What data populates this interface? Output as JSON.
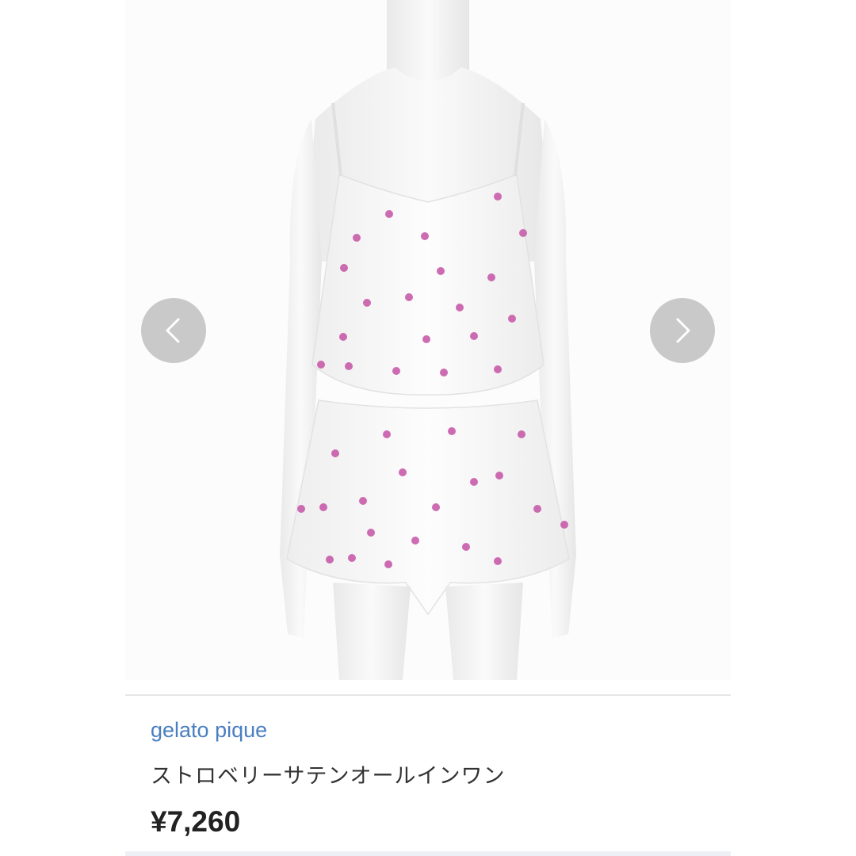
{
  "product": {
    "brand": "gelato pique",
    "name": "ストロベリーサテンオールインワン",
    "price": "¥7,260"
  },
  "carousel": {
    "prev_icon": "chevron-left-icon",
    "next_icon": "chevron-right-icon"
  },
  "colors": {
    "brand_link": "#4a7fc1",
    "dot_pink": "#c653a6",
    "nav_bg": "#c9c9c9"
  }
}
